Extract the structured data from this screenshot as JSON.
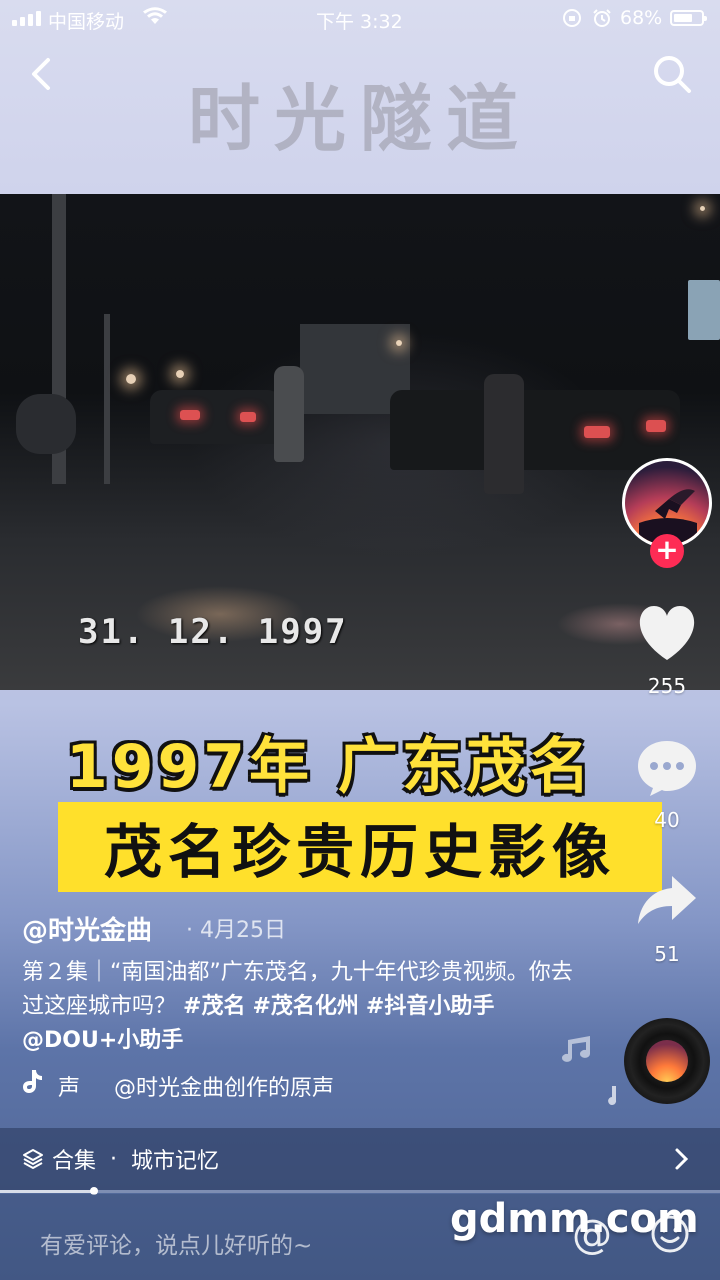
{
  "status_bar": {
    "carrier": "中国移动",
    "time": "下午 3:32",
    "battery_percent": "68%",
    "battery_level": 0.68
  },
  "video": {
    "overlay_title": "时光隧道",
    "date_stamp": "31. 12. 1997",
    "caption_line1": "1997年 广东茂名",
    "caption_line2": "茂名珍贵历史影像"
  },
  "actions": {
    "likes": "255",
    "comments": "40",
    "shares": "51"
  },
  "post": {
    "author": "@时光金曲",
    "date": "· 4月25日",
    "description_prefix": "第２集｜“南国油都”广东茂名，九十年代珍贵视频。你去过这座城市吗？",
    "hashtags": [
      "#茂名",
      "#茂名化州",
      "#抖音小助手"
    ],
    "mention": "@DOU+小助手",
    "music_left": "声",
    "music_text": "@时光金曲创作的原声"
  },
  "collection": {
    "label": "合集",
    "separator": "·",
    "name": "城市记忆"
  },
  "playback_progress": 0.13,
  "comment_bar": {
    "placeholder": "有爱评论，说点儿好听的~",
    "watermark": "gdmm.com"
  },
  "colors": {
    "accent_red": "#fe2c55",
    "caption_yellow": "#ffe23b"
  }
}
